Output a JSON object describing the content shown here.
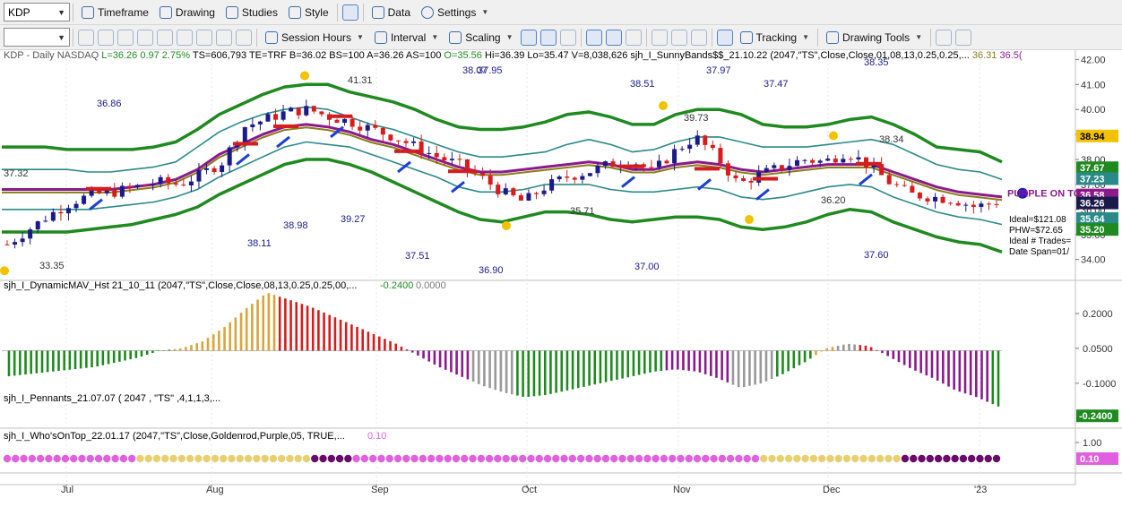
{
  "toolbar1": {
    "symbol": "KDP",
    "buttons": [
      {
        "name": "timeframe",
        "label": "Timeframe"
      },
      {
        "name": "drawing",
        "label": "Drawing"
      },
      {
        "name": "studies",
        "label": "Studies"
      },
      {
        "name": "style",
        "label": "Style"
      },
      {
        "name": "data",
        "label": "Data"
      },
      {
        "name": "settings",
        "label": "Settings"
      }
    ]
  },
  "toolbar2": {
    "buttons": [
      {
        "name": "session-hours",
        "label": "Session Hours"
      },
      {
        "name": "interval",
        "label": "Interval"
      },
      {
        "name": "scaling",
        "label": "Scaling"
      },
      {
        "name": "tracking",
        "label": "Tracking"
      },
      {
        "name": "drawing-tools",
        "label": "Drawing Tools"
      }
    ]
  },
  "colors": {
    "green": "#1f8a1f",
    "teal": "#2a8a8a",
    "purple": "#8b1a8b",
    "olive": "#8b7d1a",
    "up": "#1a1a8b",
    "down": "#d61c1c",
    "gold": "#f2c200",
    "magenta": "#e060e0",
    "darkpurple": "#6a0a6a"
  },
  "chart_data": [
    {
      "type": "candlestick",
      "header": {
        "symbol": "KDP - Daily NASDAQ",
        "L": "L=36.26",
        "chg": "0.97",
        "pct": "2.75%",
        "TS": "TS=606,793",
        "TE": "TE=TRF",
        "B": "B=36.02",
        "BS": "BS=100",
        "A": "A=36.26",
        "AS": "AS=100",
        "O": "O=35.56",
        "Hi": "Hi=36.39",
        "Lo": "Lo=35.47",
        "V": "V=8,038,626",
        "study": "sjh_I_SunnyBands$$_21.10.22 (2047,\"TS\",Close,Close,01,08,13,0.25,0.25,...",
        "study_v1": "36.31",
        "study_v2": "36.5("
      },
      "x_labels": [
        "Jul",
        "Aug",
        "Sep",
        "Oct",
        "Nov",
        "Dec",
        "'23"
      ],
      "y_ticks": [
        "42.00",
        "41.00",
        "40.00",
        "39.00",
        "38.00",
        "37.00",
        "36.00",
        "35.00",
        "34.00"
      ],
      "ylim": [
        33.2,
        42.3
      ],
      "price_badges": [
        {
          "text": "38.94",
          "color": "#f2c200",
          "fg": "#000"
        },
        {
          "text": "37.67",
          "color": "#1f8a1f",
          "fg": "#fff"
        },
        {
          "text": "37.23",
          "color": "#2a8a8a",
          "fg": "#fff"
        },
        {
          "text": "36.58",
          "color": "#8b1a8b",
          "fg": "#fff"
        },
        {
          "text": "36.26",
          "color": "#1a1a4a",
          "fg": "#fff"
        },
        {
          "text": "35.64",
          "color": "#2a8a8a",
          "fg": "#fff"
        },
        {
          "text": "35.20",
          "color": "#1f8a1f",
          "fg": "#fff"
        }
      ],
      "annotations": [
        {
          "text": "36.86",
          "color": "#1a1a8b"
        },
        {
          "text": "37.32",
          "color": "#333"
        },
        {
          "text": "33.35",
          "color": "#333"
        },
        {
          "text": "41.31",
          "color": "#333"
        },
        {
          "text": "38.98",
          "color": "#1a1a8b"
        },
        {
          "text": "39.27",
          "color": "#1a1a8b"
        },
        {
          "text": "38.11",
          "color": "#1a1a8b"
        },
        {
          "text": "37.51",
          "color": "#1a1a8b"
        },
        {
          "text": "38.07",
          "color": "#1a1a8b"
        },
        {
          "text": "37.95",
          "color": "#1a1a8b"
        },
        {
          "text": "36.90",
          "color": "#1a1a8b"
        },
        {
          "text": "35.71",
          "color": "#333"
        },
        {
          "text": "38.51",
          "color": "#1a1a8b"
        },
        {
          "text": "37.97",
          "color": "#1a1a8b"
        },
        {
          "text": "39.73",
          "color": "#333"
        },
        {
          "text": "37.00",
          "color": "#1a1a8b"
        },
        {
          "text": "37.47",
          "color": "#1a1a8b"
        },
        {
          "text": "38.35",
          "color": "#1a1a8b"
        },
        {
          "text": "38.34",
          "color": "#333"
        },
        {
          "text": "36.20",
          "color": "#333"
        },
        {
          "text": "37.60",
          "color": "#1a1a8b"
        }
      ],
      "side_text": {
        "title": "PURPLE ON TO",
        "lines": [
          "Ideal=$121.08",
          "PHW=$72.65",
          "Ideal # Trades=",
          "Date Span=01/"
        ]
      },
      "bands": {
        "outer_upper": [
          38.5,
          38.5,
          38.5,
          38.4,
          38.4,
          38.4,
          38.4,
          38.5,
          38.7,
          39.2,
          39.8,
          40.2,
          40.6,
          40.9,
          41.0,
          41.0,
          40.7,
          40.5,
          40.3,
          40.0,
          39.6,
          39.3,
          39.2,
          39.2,
          39.3,
          39.5,
          39.8,
          39.9,
          39.7,
          39.4,
          39.4,
          39.8,
          40.0,
          40.0,
          39.8,
          39.4,
          39.3,
          39.3,
          39.4,
          39.6,
          39.7,
          39.4,
          39.0,
          38.5,
          38.4,
          38.3,
          37.9
        ],
        "inner_upper": [
          37.6,
          37.6,
          37.6,
          37.6,
          37.5,
          37.5,
          37.6,
          37.7,
          37.9,
          38.5,
          39.1,
          39.5,
          39.8,
          40.0,
          40.1,
          40.0,
          39.7,
          39.4,
          39.2,
          38.9,
          38.6,
          38.3,
          38.1,
          38.1,
          38.2,
          38.3,
          38.6,
          38.8,
          38.6,
          38.3,
          38.4,
          38.7,
          38.9,
          38.9,
          38.7,
          38.5,
          38.5,
          38.5,
          38.6,
          38.7,
          38.8,
          38.6,
          38.2,
          37.8,
          37.6,
          37.5,
          37.2
        ],
        "center": [
          36.8,
          36.8,
          36.8,
          36.8,
          36.8,
          36.8,
          36.9,
          37.0,
          37.2,
          37.6,
          38.2,
          38.6,
          39.0,
          39.3,
          39.4,
          39.3,
          39.1,
          38.8,
          38.6,
          38.3,
          38.0,
          37.7,
          37.5,
          37.5,
          37.6,
          37.7,
          37.8,
          37.9,
          37.8,
          37.6,
          37.6,
          37.8,
          37.9,
          37.8,
          37.6,
          37.5,
          37.6,
          37.7,
          37.8,
          37.8,
          37.8,
          37.5,
          37.2,
          36.9,
          36.7,
          36.6,
          36.5
        ],
        "inner_lower": [
          36.0,
          36.0,
          36.0,
          36.0,
          36.0,
          36.1,
          36.2,
          36.3,
          36.5,
          36.8,
          37.3,
          37.7,
          38.1,
          38.5,
          38.7,
          38.6,
          38.5,
          38.2,
          37.9,
          37.6,
          37.3,
          36.9,
          36.7,
          36.7,
          36.8,
          37.0,
          37.0,
          37.0,
          36.8,
          36.7,
          36.7,
          36.8,
          36.9,
          36.8,
          36.5,
          36.4,
          36.5,
          36.7,
          36.9,
          37.0,
          36.9,
          36.5,
          36.2,
          35.9,
          35.7,
          35.6,
          35.4
        ],
        "outer_lower": [
          35.1,
          35.1,
          35.1,
          35.1,
          35.2,
          35.3,
          35.4,
          35.6,
          35.8,
          36.1,
          36.6,
          37.0,
          37.4,
          37.8,
          38.0,
          38.0,
          37.8,
          37.5,
          37.1,
          36.7,
          36.3,
          35.9,
          35.6,
          35.5,
          35.7,
          35.9,
          35.9,
          35.8,
          35.6,
          35.5,
          35.6,
          35.7,
          35.7,
          35.6,
          35.3,
          35.2,
          35.3,
          35.5,
          35.8,
          36.0,
          35.9,
          35.5,
          35.2,
          34.9,
          34.7,
          34.6,
          34.3
        ]
      },
      "closes": [
        34.6,
        35.2,
        35.8,
        36.3,
        36.6,
        36.7,
        36.9,
        37.1,
        37.0,
        37.4,
        37.9,
        39.3,
        39.6,
        39.9,
        40.0,
        39.7,
        39.5,
        39.2,
        38.9,
        38.5,
        38.1,
        37.8,
        37.3,
        36.7,
        36.3,
        36.9,
        37.3,
        37.5,
        37.8,
        38.0,
        37.5,
        38.3,
        38.9,
        38.1,
        37.0,
        37.4,
        37.7,
        38.0,
        37.9,
        38.3,
        37.8,
        37.1,
        36.6,
        36.5,
        36.4,
        36.1,
        36.3
      ],
      "macd_values": [
        -0.11,
        -0.1,
        -0.09,
        -0.08,
        -0.07,
        -0.05,
        -0.03,
        0.0,
        0.01,
        0.04,
        0.1,
        0.18,
        0.25,
        0.22,
        0.19,
        0.15,
        0.11,
        0.07,
        0.03,
        -0.02,
        -0.07,
        -0.11,
        -0.15,
        -0.18,
        -0.2,
        -0.19,
        -0.17,
        -0.15,
        -0.13,
        -0.11,
        -0.09,
        -0.08,
        -0.09,
        -0.12,
        -0.16,
        -0.14,
        -0.1,
        -0.05,
        0.01,
        0.03,
        0.02,
        -0.03,
        -0.08,
        -0.12,
        -0.17,
        -0.2,
        -0.24
      ],
      "macd_colors": [
        "#1f8a1f",
        "#1f8a1f",
        "#1f8a1f",
        "#1f8a1f",
        "#1f8a1f",
        "#1f8a1f",
        "#1f8a1f",
        "#1f8a1f",
        "#d9a43a",
        "#d9a43a",
        "#d9a43a",
        "#d9a43a",
        "#d9a43a",
        "#d61c1c",
        "#d61c1c",
        "#d61c1c",
        "#d61c1c",
        "#d61c1c",
        "#d61c1c",
        "#8b1a8b",
        "#8b1a8b",
        "#8b1a8b",
        "#999999",
        "#999999",
        "#1f8a1f",
        "#1f8a1f",
        "#1f8a1f",
        "#1f8a1f",
        "#1f8a1f",
        "#1f8a1f",
        "#1f8a1f",
        "#8b1a8b",
        "#8b1a8b",
        "#8b1a8b",
        "#999999",
        "#999999",
        "#1f8a1f",
        "#1f8a1f",
        "#d9a43a",
        "#999999",
        "#d61c1c",
        "#8b1a8b",
        "#8b1a8b",
        "#8b1a8b",
        "#8b1a8b",
        "#8b1a8b",
        "#1f8a1f"
      ],
      "macd_ticks": [
        "0.2000",
        "0.0500",
        "-0.1000"
      ],
      "macd_label": "sjh_I_DynamicMAV_Hst 21_10_11 (2047,\"TS\",Close,Close,08,13,0.25,0.25,00,...",
      "macd_v1": "-0.2400",
      "macd_v2": "0.0000",
      "macd_badge": "-0.2400",
      "pennants_label": "sjh_I_Pennants_21.07.07 ( 2047 , \"TS\" ,4,1,1,3,...",
      "whos_label": "sjh_I_Who'sOnTop_22.01.17 (2047,\"TS\",Close,Goldenrod,Purple,05, TRUE,...",
      "whos_value": "0.10",
      "whos_ticks": [
        "1.00",
        "0.10"
      ],
      "whos_badge": "0.10",
      "whos_colors": [
        "m",
        "m",
        "m",
        "m",
        "m",
        "m",
        "m",
        "m",
        "m",
        "m",
        "m",
        "m",
        "g",
        "g",
        "g",
        "g",
        "g",
        "g",
        "g",
        "g",
        "g",
        "g",
        "g",
        "g",
        "g",
        "g",
        "g",
        "d",
        "d",
        "d",
        "d",
        "m",
        "m",
        "m",
        "m",
        "m",
        "m",
        "m",
        "m",
        "m",
        "m",
        "m",
        "m",
        "m",
        "m",
        "m",
        "m",
        "m",
        "m",
        "m",
        "m",
        "m",
        "m",
        "m",
        "m",
        "m",
        "m",
        "m",
        "m",
        "m",
        "m",
        "m",
        "m",
        "m",
        "m",
        "m",
        "m",
        "g",
        "g",
        "g",
        "g",
        "g",
        "g",
        "g",
        "g",
        "g",
        "g",
        "g",
        "g",
        "d",
        "d",
        "d",
        "d",
        "d",
        "d",
        "d",
        "d",
        "d"
      ]
    }
  ]
}
